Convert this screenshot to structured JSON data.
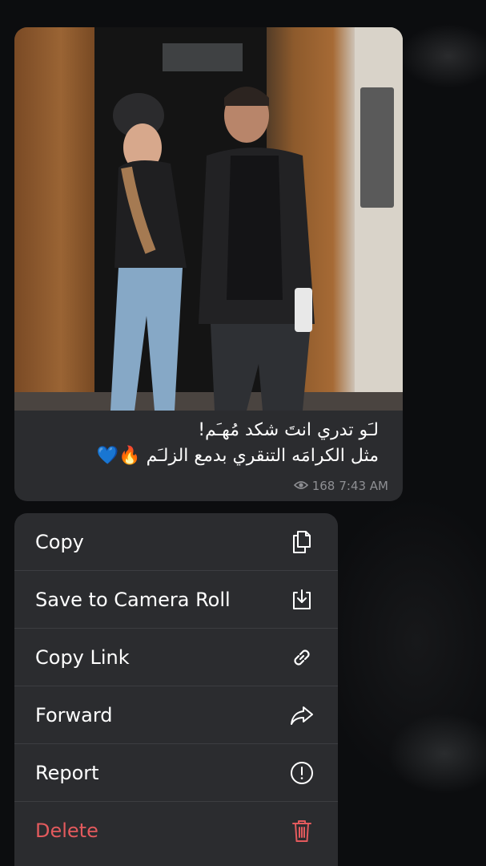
{
  "message": {
    "caption_line1": "لـَو تدري انتَ شكد مُهـَم!",
    "caption_line2": "مثل الكرامَه التنقري بدمع الزلـَم 🔥💙",
    "views": "168",
    "time": "7:43 AM"
  },
  "menu": {
    "items": [
      {
        "label": "Copy",
        "icon": "copy-icon"
      },
      {
        "label": "Save to Camera Roll",
        "icon": "save-icon"
      },
      {
        "label": "Copy Link",
        "icon": "link-icon"
      },
      {
        "label": "Forward",
        "icon": "forward-icon"
      },
      {
        "label": "Report",
        "icon": "report-icon"
      },
      {
        "label": "Delete",
        "icon": "trash-icon"
      }
    ]
  },
  "colors": {
    "bubble_bg": "#2b2c2f",
    "danger": "#e35a5d",
    "meta": "#8e8f93"
  }
}
